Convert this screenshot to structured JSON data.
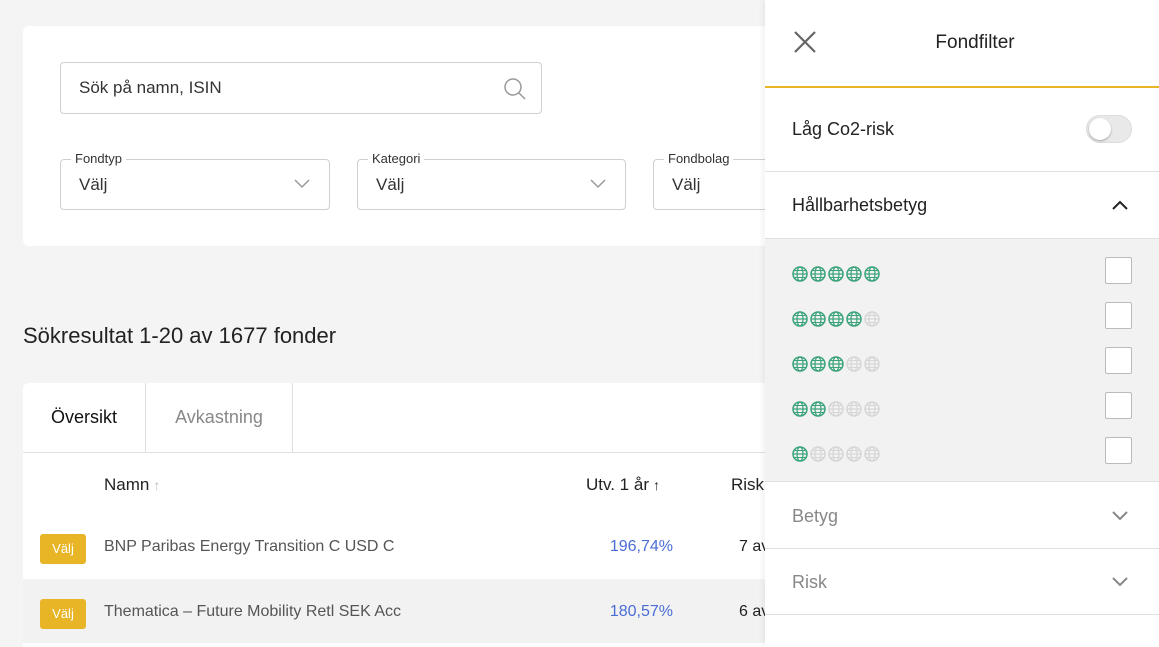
{
  "search": {
    "placeholder": "Sök på namn, ISIN"
  },
  "filters": [
    {
      "label": "Fondtyp",
      "value": "Välj"
    },
    {
      "label": "Kategori",
      "value": "Välj"
    },
    {
      "label": "Fondbolag",
      "value": "Välj"
    }
  ],
  "results": {
    "title": "Sökresultat 1-20 av 1677 fonder",
    "tabs": [
      "Översikt",
      "Avkastning"
    ],
    "columns": {
      "name": "Namn",
      "name_arrow": "↑",
      "return": "Utv. 1 år",
      "return_arrow": "↑",
      "risk": "Risk"
    },
    "rows": [
      {
        "button": "Välj",
        "name": "BNP Paribas Energy Transition C USD C",
        "return": "196,74%",
        "risk": "7 av"
      },
      {
        "button": "Välj",
        "name": "Thematica – Future Mobility Retl SEK Acc",
        "return": "180,57%",
        "risk": "6 av"
      }
    ]
  },
  "panel": {
    "title": "Fondfilter",
    "co2_label": "Låg Co2-risk",
    "co2_enabled": false,
    "sustainability_label": "Hållbarhetsbetyg",
    "sustainability_ratings": [
      5,
      4,
      3,
      2,
      1
    ],
    "rating_label": "Betyg",
    "risk_label": "Risk"
  },
  "colors": {
    "accent": "#e8b527",
    "globe_active": "#3aa37a",
    "globe_inactive": "#d6d6d6",
    "return_text": "#4a6dd6"
  }
}
